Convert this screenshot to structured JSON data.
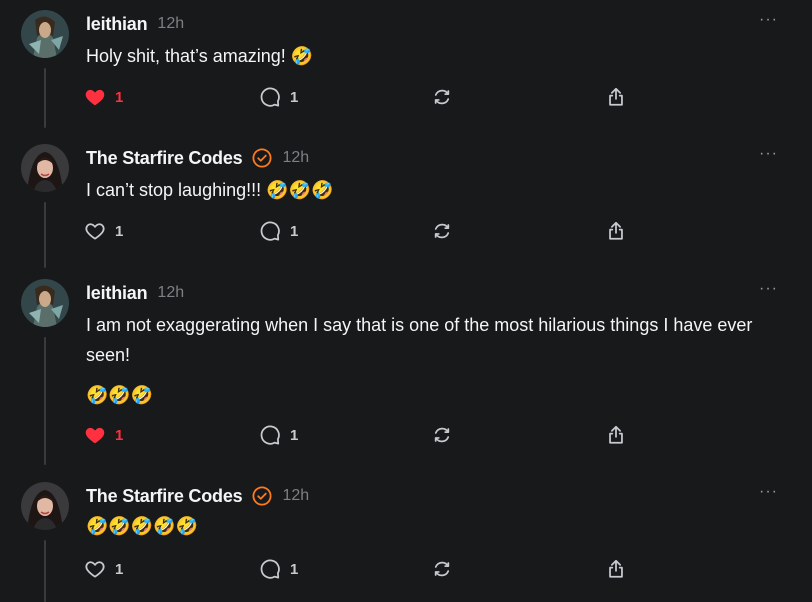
{
  "posts": [
    {
      "username": "leithian",
      "verified": false,
      "time": "12h",
      "more_label": "···",
      "text": "Holy shit, that’s amazing! 🤣",
      "extra_emoji": "",
      "liked": true,
      "like_count": "1",
      "reply_count": "1",
      "avatar_icon": "leithian-avatar",
      "accent_color": "#ff3040"
    },
    {
      "username": "The Starfire Codes",
      "verified": true,
      "time": "12h",
      "more_label": "···",
      "text": "I can’t stop laughing!!! 🤣🤣🤣",
      "extra_emoji": "",
      "liked": false,
      "like_count": "1",
      "reply_count": "1",
      "avatar_icon": "starfire-avatar",
      "accent_color": "#ff3040"
    },
    {
      "username": "leithian",
      "verified": false,
      "time": "12h",
      "more_label": "···",
      "text": "I am not exaggerating when I say that is one of the most hilarious things I have ever seen!",
      "extra_emoji": "🤣🤣🤣",
      "liked": true,
      "like_count": "1",
      "reply_count": "1",
      "avatar_icon": "leithian-avatar",
      "accent_color": "#ff3040"
    },
    {
      "username": "The Starfire Codes",
      "verified": true,
      "time": "12h",
      "more_label": "···",
      "text": "🤣🤣🤣🤣🤣",
      "extra_emoji": "",
      "liked": false,
      "like_count": "1",
      "reply_count": "1",
      "avatar_icon": "starfire-avatar",
      "accent_color": "#ff3040"
    }
  ],
  "colors": {
    "background": "#18191b",
    "text": "#f3f5f7",
    "muted": "#7d7f84",
    "like": "#ff3040",
    "verified_badge": "#ff7a1a",
    "thread_line": "#3a3b3e"
  }
}
